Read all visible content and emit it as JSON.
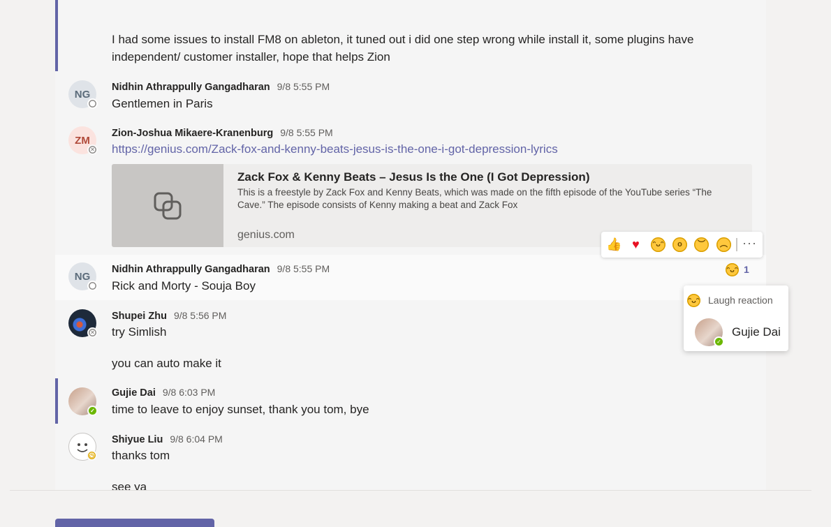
{
  "messages": [
    {
      "text": "I had some issues to install FM8 on ableton, it tuned out i did one step wrong while install it, some plugins have",
      "text2": "independent/ customer installer, hope that helps Zion"
    },
    {
      "initials": "NG",
      "author": "Nidhin Athrappully Gangadharan",
      "time": "9/8 5:55 PM",
      "text": "Gentlemen in Paris"
    },
    {
      "initials": "ZM",
      "author": "Zion-Joshua Mikaere-Kranenburg",
      "time": "9/8 5:55 PM",
      "link": "https://genius.com/Zack-fox-and-kenny-beats-jesus-is-the-one-i-got-depression-lyrics",
      "card": {
        "title": "Zack Fox & Kenny Beats – Jesus Is the One (I Got Depression)",
        "description": "This is a freestyle by Zack Fox and Kenny Beats, which was made on the fifth episode of the YouTube series “The Cave.” The episode consists of Kenny making a beat and Zack Fox",
        "domain": "genius.com"
      }
    },
    {
      "initials": "NG",
      "author": "Nidhin Athrappully Gangadharan",
      "time": "9/8 5:55 PM",
      "text": "Rick and Morty - Souja Boy",
      "reaction_count": "1"
    },
    {
      "author": "Shupei Zhu",
      "time": "9/8 5:56 PM",
      "text": "try Simlish",
      "text2": "you can auto make it"
    },
    {
      "author": "Gujie Dai",
      "time": "9/8 6:03 PM",
      "text": "time to leave to enjoy sunset, thank you tom, bye"
    },
    {
      "author": "Shiyue Liu",
      "time": "9/8 6:04 PM",
      "text": "thanks tom",
      "text2": "see ya"
    }
  ],
  "reaction_bar": {
    "items": [
      "like",
      "heart",
      "laugh",
      "surprised",
      "sad",
      "angry"
    ],
    "more": "···"
  },
  "tooltip": {
    "label": "Laugh reaction",
    "user": "Gujie Dai"
  },
  "colors": {
    "accent": "#6264a7",
    "available": "#6bb700",
    "away": "#e0a800",
    "heart": "#e81123"
  }
}
